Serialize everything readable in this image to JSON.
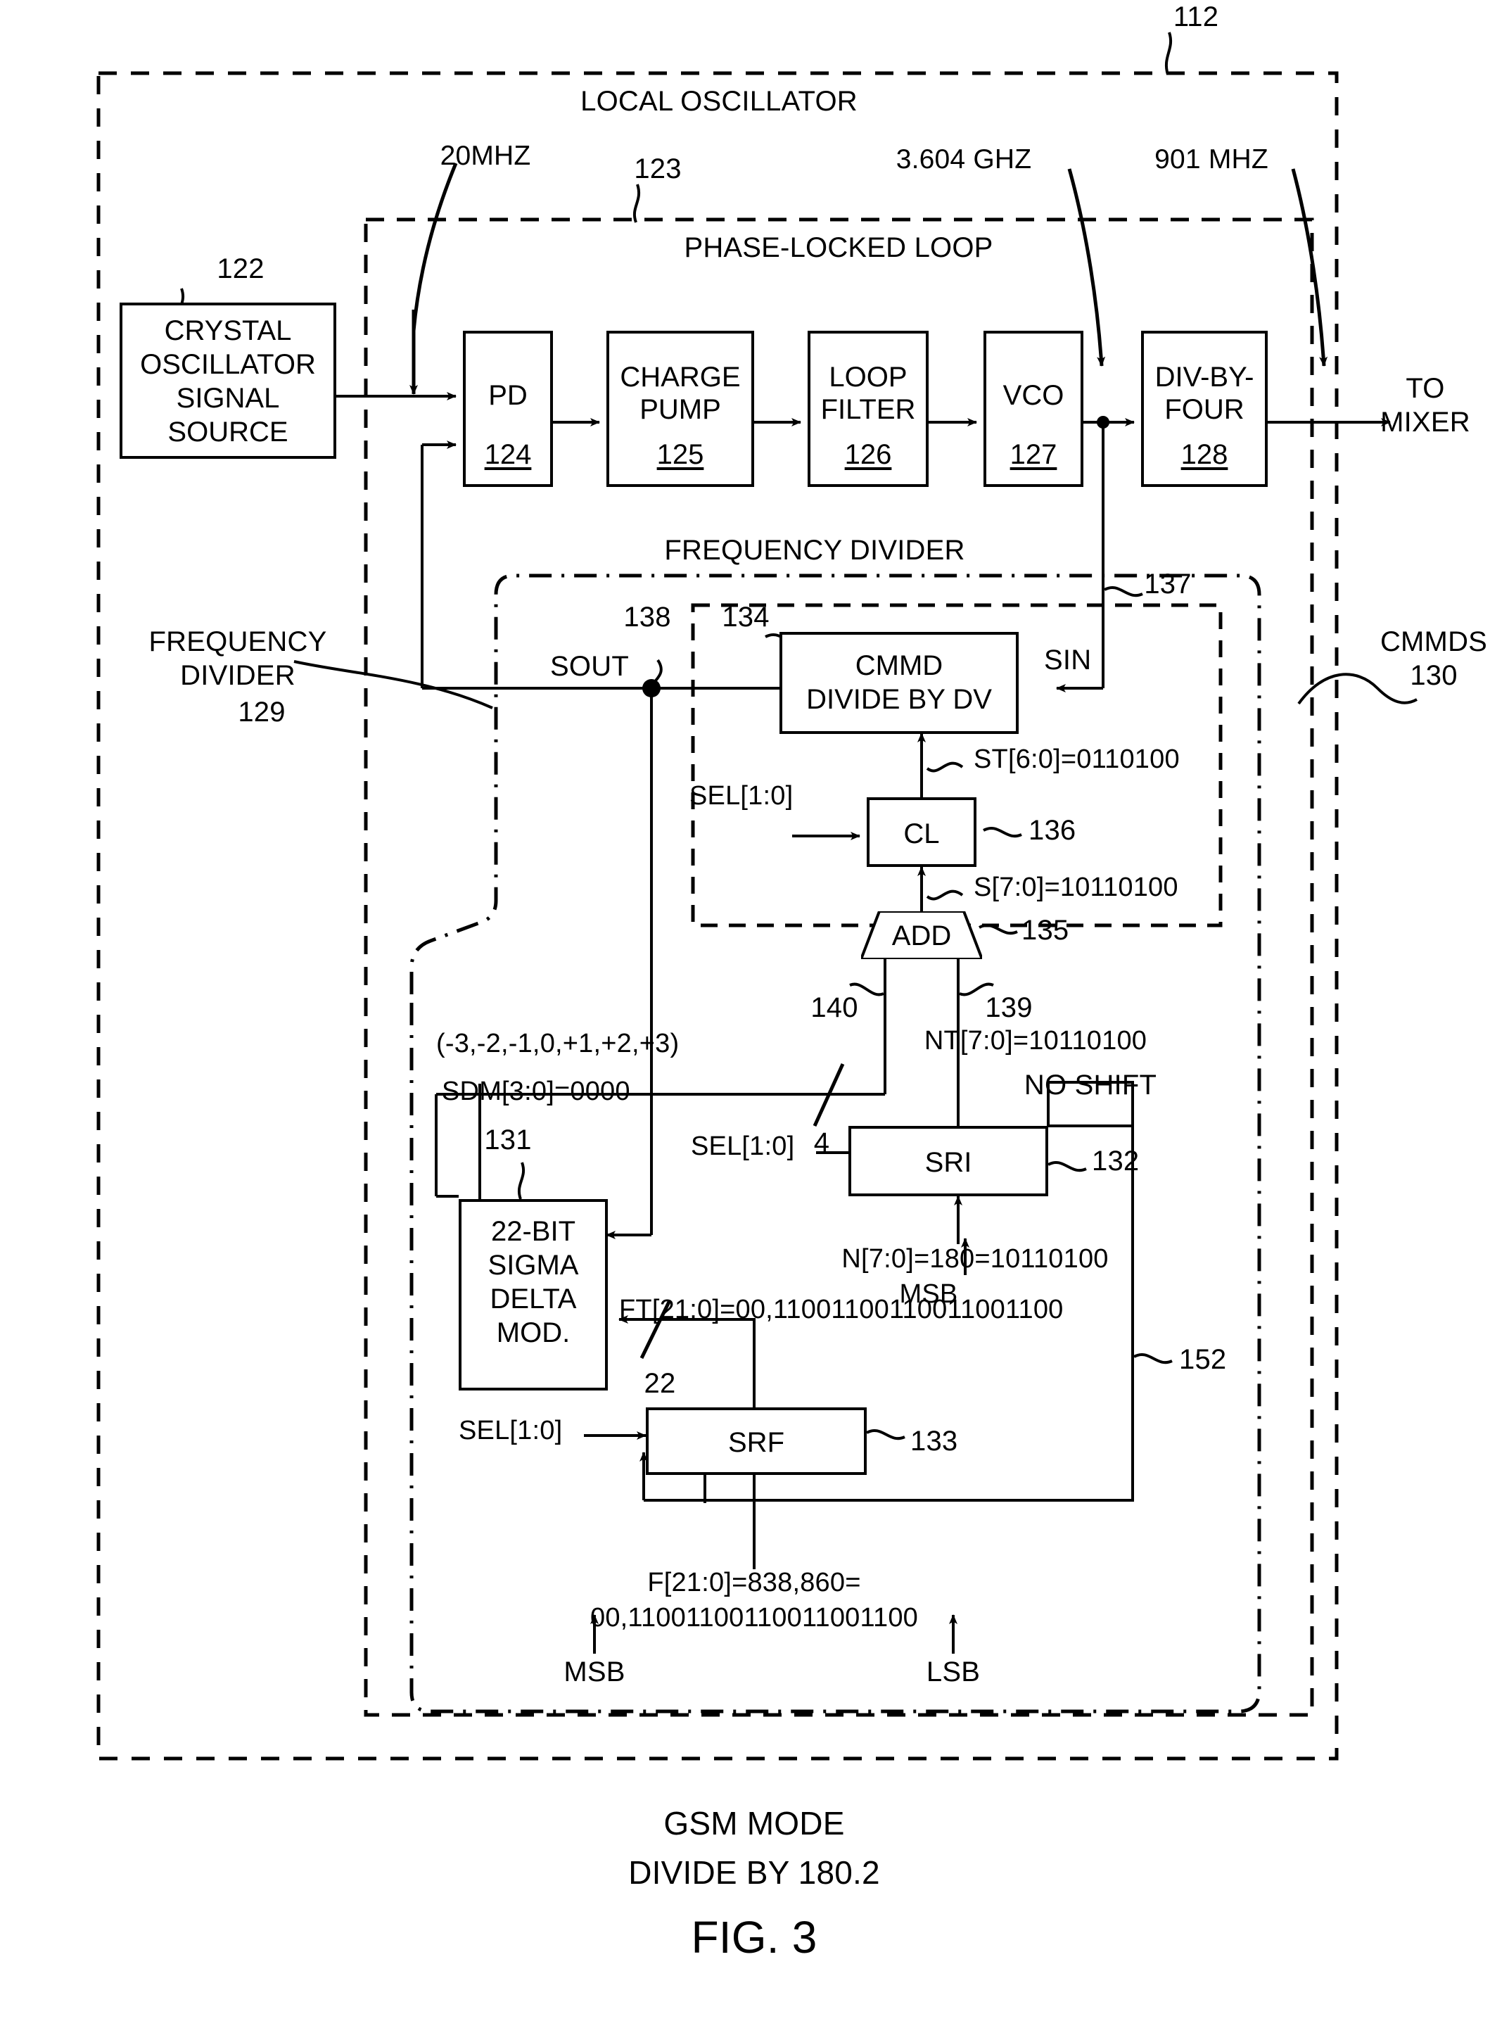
{
  "figure": {
    "ref_112": "112",
    "caption_line1": "GSM MODE",
    "caption_line2": "DIVIDE BY 180.2",
    "fig_number": "FIG. 3"
  },
  "containers": {
    "local_oscillator": {
      "title": "LOCAL OSCILLATOR",
      "ref": "112"
    },
    "phase_locked_loop": {
      "title": "PHASE-LOCKED LOOP",
      "ref": "123"
    },
    "frequency_divider_outer": {
      "title": "FREQUENCY DIVIDER",
      "ref_label_line1": "FREQUENCY",
      "ref_label_line2": "DIVIDER",
      "ref": "129"
    },
    "cmmds": {
      "label": "CMMDS",
      "ref": "130"
    }
  },
  "blocks": {
    "crystal": {
      "l1": "CRYSTAL",
      "l2": "OSCILLATOR",
      "l3": "SIGNAL",
      "l4": "SOURCE",
      "ref": "122"
    },
    "pd": {
      "label": "PD",
      "ref": "124"
    },
    "charge_pump": {
      "l1": "CHARGE",
      "l2": "PUMP",
      "ref": "125"
    },
    "loop_filter": {
      "l1": "LOOP",
      "l2": "FILTER",
      "ref": "126"
    },
    "vco": {
      "label": "VCO",
      "ref": "127"
    },
    "div_by_four": {
      "l1": "DIV-BY-",
      "l2": "FOUR",
      "ref": "128"
    },
    "cmmd": {
      "l1": "CMMD",
      "l2": "DIVIDE BY DV",
      "ref": "134"
    },
    "cl": {
      "label": "CL",
      "ref": "136"
    },
    "add": {
      "label": "ADD",
      "ref": "135"
    },
    "sri": {
      "label": "SRI",
      "ref": "132"
    },
    "srf": {
      "label": "SRF",
      "ref": "133"
    },
    "sigma_delta": {
      "l1": "22-BIT",
      "l2": "SIGMA",
      "l3": "DELTA",
      "l4": "MOD.",
      "ref": "131"
    }
  },
  "signals": {
    "f_20mhz": "20MHZ",
    "f_3604ghz": "3.604 GHZ",
    "f_901mhz": "901 MHZ",
    "to_mixer_l1": "TO",
    "to_mixer_l2": "MIXER",
    "sout": "SOUT",
    "sout_ref": "138",
    "sin": "SIN",
    "sin_ref": "137",
    "st_bus": "ST[6:0]=0110100",
    "s_bus": "S[7:0]=10110100",
    "sel_cl": "SEL[1:0]",
    "sel_sri": "SEL[1:0]",
    "sel_srf": "SEL[1:0]",
    "add_in_left_ref": "140",
    "add_in_right_ref": "139",
    "sdm_range": "(-3,-2,-1,0,+1,+2,+3)",
    "sdm_width": "4",
    "sdm_value": "SDM[3:0]=0000",
    "nt_bus": "NT[7:0]=10110100",
    "no_shift": "NO SHIFT",
    "n_bus": "N[7:0]=180=10110100",
    "n_msb": "MSB",
    "ft_bus": "FT[21:0]=00,1100110011001100 1100",
    "ft_bus_text": "FT[21:0]=00,11001100110011001100",
    "ft_width": "22",
    "f_bus_l1": "F[21:0]=838,860=",
    "f_bus_l2": "00,11001100110011001100",
    "f_msb": "MSB",
    "f_lsb": "LSB",
    "feedback_ref_152": "152"
  },
  "colors": {
    "ink": "#000000",
    "paper": "#ffffff"
  }
}
